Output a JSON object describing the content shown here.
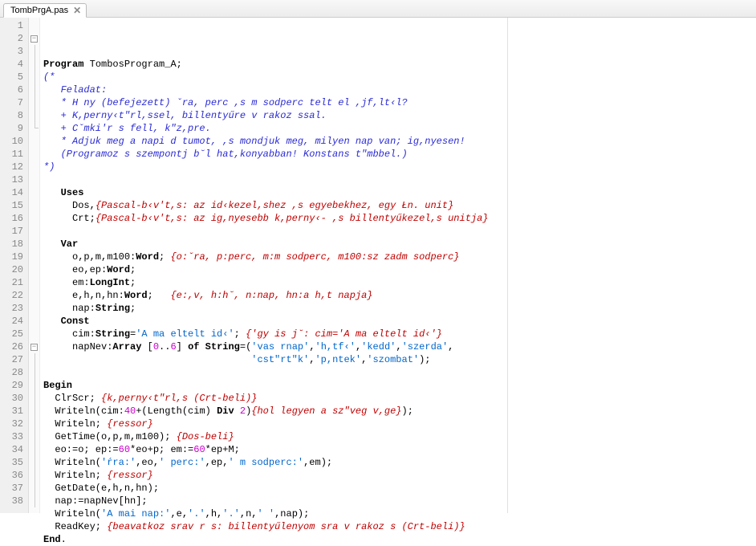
{
  "tab": {
    "label": "TombPrgA.pas",
    "close_glyph": "✕"
  },
  "line_count": 38,
  "fold_markers": {
    "2": "minus",
    "9": "end",
    "26": "minus"
  },
  "code_lines": [
    [
      {
        "t": "kw",
        "v": "Program"
      },
      {
        "t": "p",
        "v": " TombosProgram_A;"
      }
    ],
    [
      {
        "t": "cm",
        "v": "(*"
      }
    ],
    [
      {
        "t": "cm",
        "v": "   Feladat:"
      }
    ],
    [
      {
        "t": "cm",
        "v": "   * H ny (befejezett) ˇra, perc ,s m sodperc telt el ,jf,lt‹l?"
      }
    ],
    [
      {
        "t": "cm",
        "v": "   + K,perny‹t\"rl,ssel, billentyűre v rakoz ssal."
      }
    ],
    [
      {
        "t": "cm",
        "v": "   + Cˇmki'r s fell, k\"z,pre."
      }
    ],
    [
      {
        "t": "cm",
        "v": "   * Adjuk meg a napi d tumot, ,s mondjuk meg, milyen nap van; ig,nyesen!"
      }
    ],
    [
      {
        "t": "cm",
        "v": "   (Programoz s szempontj b˘l hat,konyabban! Konstans t\"mbbel.)"
      }
    ],
    [
      {
        "t": "cm",
        "v": "*)"
      }
    ],
    [],
    [
      {
        "t": "p",
        "v": "   "
      },
      {
        "t": "kw",
        "v": "Uses"
      }
    ],
    [
      {
        "t": "p",
        "v": "     Dos,"
      },
      {
        "t": "cmr",
        "v": "{Pascal-b‹v't,s: az id‹kezel,shez ,s egyebekhez, egy Łn. unit}"
      }
    ],
    [
      {
        "t": "p",
        "v": "     Crt;"
      },
      {
        "t": "cmr",
        "v": "{Pascal-b‹v't,s: az ig,nyesebb k,perny‹- ,s billentyűkezel,s unitja}"
      }
    ],
    [],
    [
      {
        "t": "p",
        "v": "   "
      },
      {
        "t": "kw",
        "v": "Var"
      }
    ],
    [
      {
        "t": "p",
        "v": "     o,p,m,m100:"
      },
      {
        "t": "kw",
        "v": "Word"
      },
      {
        "t": "p",
        "v": "; "
      },
      {
        "t": "cmr",
        "v": "{o:ˇra, p:perc, m:m sodperc, m100:sz zadm sodperc}"
      }
    ],
    [
      {
        "t": "p",
        "v": "     eo,ep:"
      },
      {
        "t": "kw",
        "v": "Word"
      },
      {
        "t": "p",
        "v": ";"
      }
    ],
    [
      {
        "t": "p",
        "v": "     em:"
      },
      {
        "t": "kw",
        "v": "LongInt"
      },
      {
        "t": "p",
        "v": ";"
      }
    ],
    [
      {
        "t": "p",
        "v": "     e,h,n,hn:"
      },
      {
        "t": "kw",
        "v": "Word"
      },
      {
        "t": "p",
        "v": ";   "
      },
      {
        "t": "cmr",
        "v": "{e:,v, h:h˘, n:nap, hn:a h,t napja}"
      }
    ],
    [
      {
        "t": "p",
        "v": "     nap:"
      },
      {
        "t": "kw",
        "v": "String"
      },
      {
        "t": "p",
        "v": ";"
      }
    ],
    [
      {
        "t": "p",
        "v": "   "
      },
      {
        "t": "kw",
        "v": "Const"
      }
    ],
    [
      {
        "t": "p",
        "v": "     cim:"
      },
      {
        "t": "kw",
        "v": "String"
      },
      {
        "t": "p",
        "v": "="
      },
      {
        "t": "str",
        "v": "'A ma eltelt id‹'"
      },
      {
        "t": "p",
        "v": "; "
      },
      {
        "t": "cmr",
        "v": "{'gy is j˘: cim='A ma eltelt id‹'}"
      }
    ],
    [
      {
        "t": "p",
        "v": "     napNev:"
      },
      {
        "t": "kw",
        "v": "Array"
      },
      {
        "t": "p",
        "v": " ["
      },
      {
        "t": "num",
        "v": "0"
      },
      {
        "t": "p",
        "v": ".."
      },
      {
        "t": "num",
        "v": "6"
      },
      {
        "t": "p",
        "v": "] "
      },
      {
        "t": "kw",
        "v": "of"
      },
      {
        "t": "p",
        "v": " "
      },
      {
        "t": "kw",
        "v": "String"
      },
      {
        "t": "p",
        "v": "=("
      },
      {
        "t": "str",
        "v": "'vas rnap'"
      },
      {
        "t": "p",
        "v": ","
      },
      {
        "t": "str",
        "v": "'h,tf‹'"
      },
      {
        "t": "p",
        "v": ","
      },
      {
        "t": "str",
        "v": "'kedd'"
      },
      {
        "t": "p",
        "v": ","
      },
      {
        "t": "str",
        "v": "'szerda'"
      },
      {
        "t": "p",
        "v": ","
      }
    ],
    [
      {
        "t": "p",
        "v": "                                    "
      },
      {
        "t": "str",
        "v": "'cst\"rt\"k'"
      },
      {
        "t": "p",
        "v": ","
      },
      {
        "t": "str",
        "v": "'p,ntek'"
      },
      {
        "t": "p",
        "v": ","
      },
      {
        "t": "str",
        "v": "'szombat'"
      },
      {
        "t": "p",
        "v": ");"
      }
    ],
    [],
    [
      {
        "t": "kw",
        "v": "Begin"
      }
    ],
    [
      {
        "t": "p",
        "v": "  ClrScr; "
      },
      {
        "t": "cmr",
        "v": "{k,perny‹t\"rl,s (Crt-beli)}"
      }
    ],
    [
      {
        "t": "p",
        "v": "  Writeln(cim:"
      },
      {
        "t": "num",
        "v": "40"
      },
      {
        "t": "p",
        "v": "+(Length(cim) "
      },
      {
        "t": "kw",
        "v": "Div"
      },
      {
        "t": "p",
        "v": " "
      },
      {
        "t": "num",
        "v": "2"
      },
      {
        "t": "p",
        "v": ")"
      },
      {
        "t": "cmr",
        "v": "{hol legyen a sz\"veg v,ge}"
      },
      {
        "t": "p",
        "v": ");"
      }
    ],
    [
      {
        "t": "p",
        "v": "  Writeln; "
      },
      {
        "t": "cmr",
        "v": "{ressor}"
      }
    ],
    [
      {
        "t": "p",
        "v": "  GetTime(o,p,m,m100); "
      },
      {
        "t": "cmr",
        "v": "{Dos-beli}"
      }
    ],
    [
      {
        "t": "p",
        "v": "  eo:=o; ep:="
      },
      {
        "t": "num",
        "v": "60"
      },
      {
        "t": "p",
        "v": "*eo+p; em:="
      },
      {
        "t": "num",
        "v": "60"
      },
      {
        "t": "p",
        "v": "*ep+M;"
      }
    ],
    [
      {
        "t": "p",
        "v": "  Writeln("
      },
      {
        "t": "str",
        "v": "'ŕra:'"
      },
      {
        "t": "p",
        "v": ",eo,"
      },
      {
        "t": "str",
        "v": "' perc:'"
      },
      {
        "t": "p",
        "v": ",ep,"
      },
      {
        "t": "str",
        "v": "' m sodperc:'"
      },
      {
        "t": "p",
        "v": ",em);"
      }
    ],
    [
      {
        "t": "p",
        "v": "  Writeln; "
      },
      {
        "t": "cmr",
        "v": "{ressor}"
      }
    ],
    [
      {
        "t": "p",
        "v": "  GetDate(e,h,n,hn);"
      }
    ],
    [
      {
        "t": "p",
        "v": "  nap:=napNev[hn];"
      }
    ],
    [
      {
        "t": "p",
        "v": "  Writeln("
      },
      {
        "t": "str",
        "v": "'A mai nap:'"
      },
      {
        "t": "p",
        "v": ",e,"
      },
      {
        "t": "str",
        "v": "'.'"
      },
      {
        "t": "p",
        "v": ",h,"
      },
      {
        "t": "str",
        "v": "'.'"
      },
      {
        "t": "p",
        "v": ",n,"
      },
      {
        "t": "str",
        "v": "' '"
      },
      {
        "t": "p",
        "v": ",nap);"
      }
    ],
    [
      {
        "t": "p",
        "v": "  ReadKey; "
      },
      {
        "t": "cmr",
        "v": "{beavatkoz srav r s: billentyűlenyom sra v rakoz s (Crt-beli)}"
      }
    ],
    [
      {
        "t": "kw",
        "v": "End"
      },
      {
        "t": "p",
        "v": "."
      }
    ]
  ]
}
